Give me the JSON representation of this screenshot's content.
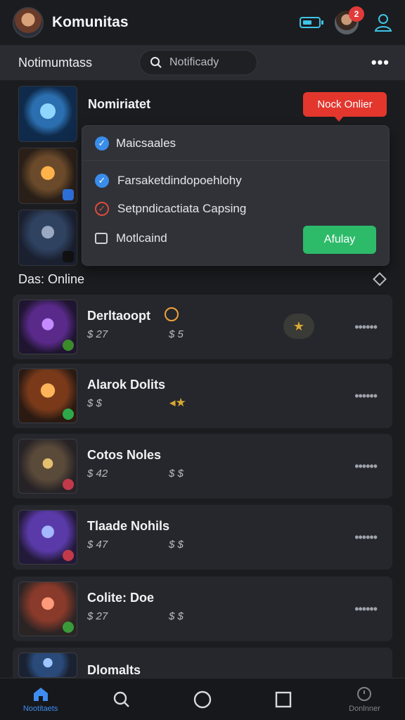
{
  "app": {
    "title": "Komunitas",
    "notification_count": "2"
  },
  "subheader": {
    "label": "Notimumtass",
    "search_placeholder": "Notificady",
    "more_label": "•••"
  },
  "featured": {
    "title": "Nomiriatet",
    "status_pill": "Nock Onlier"
  },
  "filter_menu": {
    "header": "Maicsaales",
    "options": [
      {
        "label": "Farsaketdindopoehlohy",
        "state": "checked-blue"
      },
      {
        "label": "Setpndicactiata Capsing",
        "state": "checked-red"
      },
      {
        "label": "Motlcaind",
        "state": "unchecked"
      }
    ],
    "apply_label": "Afulay"
  },
  "section": {
    "title": "Das: Online"
  },
  "games": [
    {
      "name": "Derltaoopt",
      "meta1": "$ 27",
      "meta2": "$ 5"
    },
    {
      "name": "Alarok Dolits",
      "meta1": "$ $",
      "meta2": ""
    },
    {
      "name": "Cotos Noles",
      "meta1": "$ 42",
      "meta2": "$ $"
    },
    {
      "name": "Tlaade Nohils",
      "meta1": "$ 47",
      "meta2": "$ $"
    },
    {
      "name": "Colite: Doe",
      "meta1": "$ 27",
      "meta2": "$ $"
    },
    {
      "name": "Dlomalts",
      "meta1": "",
      "meta2": ""
    }
  ],
  "nav": {
    "home": "Nootitaets",
    "search": "",
    "circle": "",
    "square": "",
    "clock": "Donlnner"
  },
  "colors": {
    "accent_blue": "#3e8df0",
    "pill_red": "#e3372e",
    "apply_green": "#2dbb6a"
  }
}
